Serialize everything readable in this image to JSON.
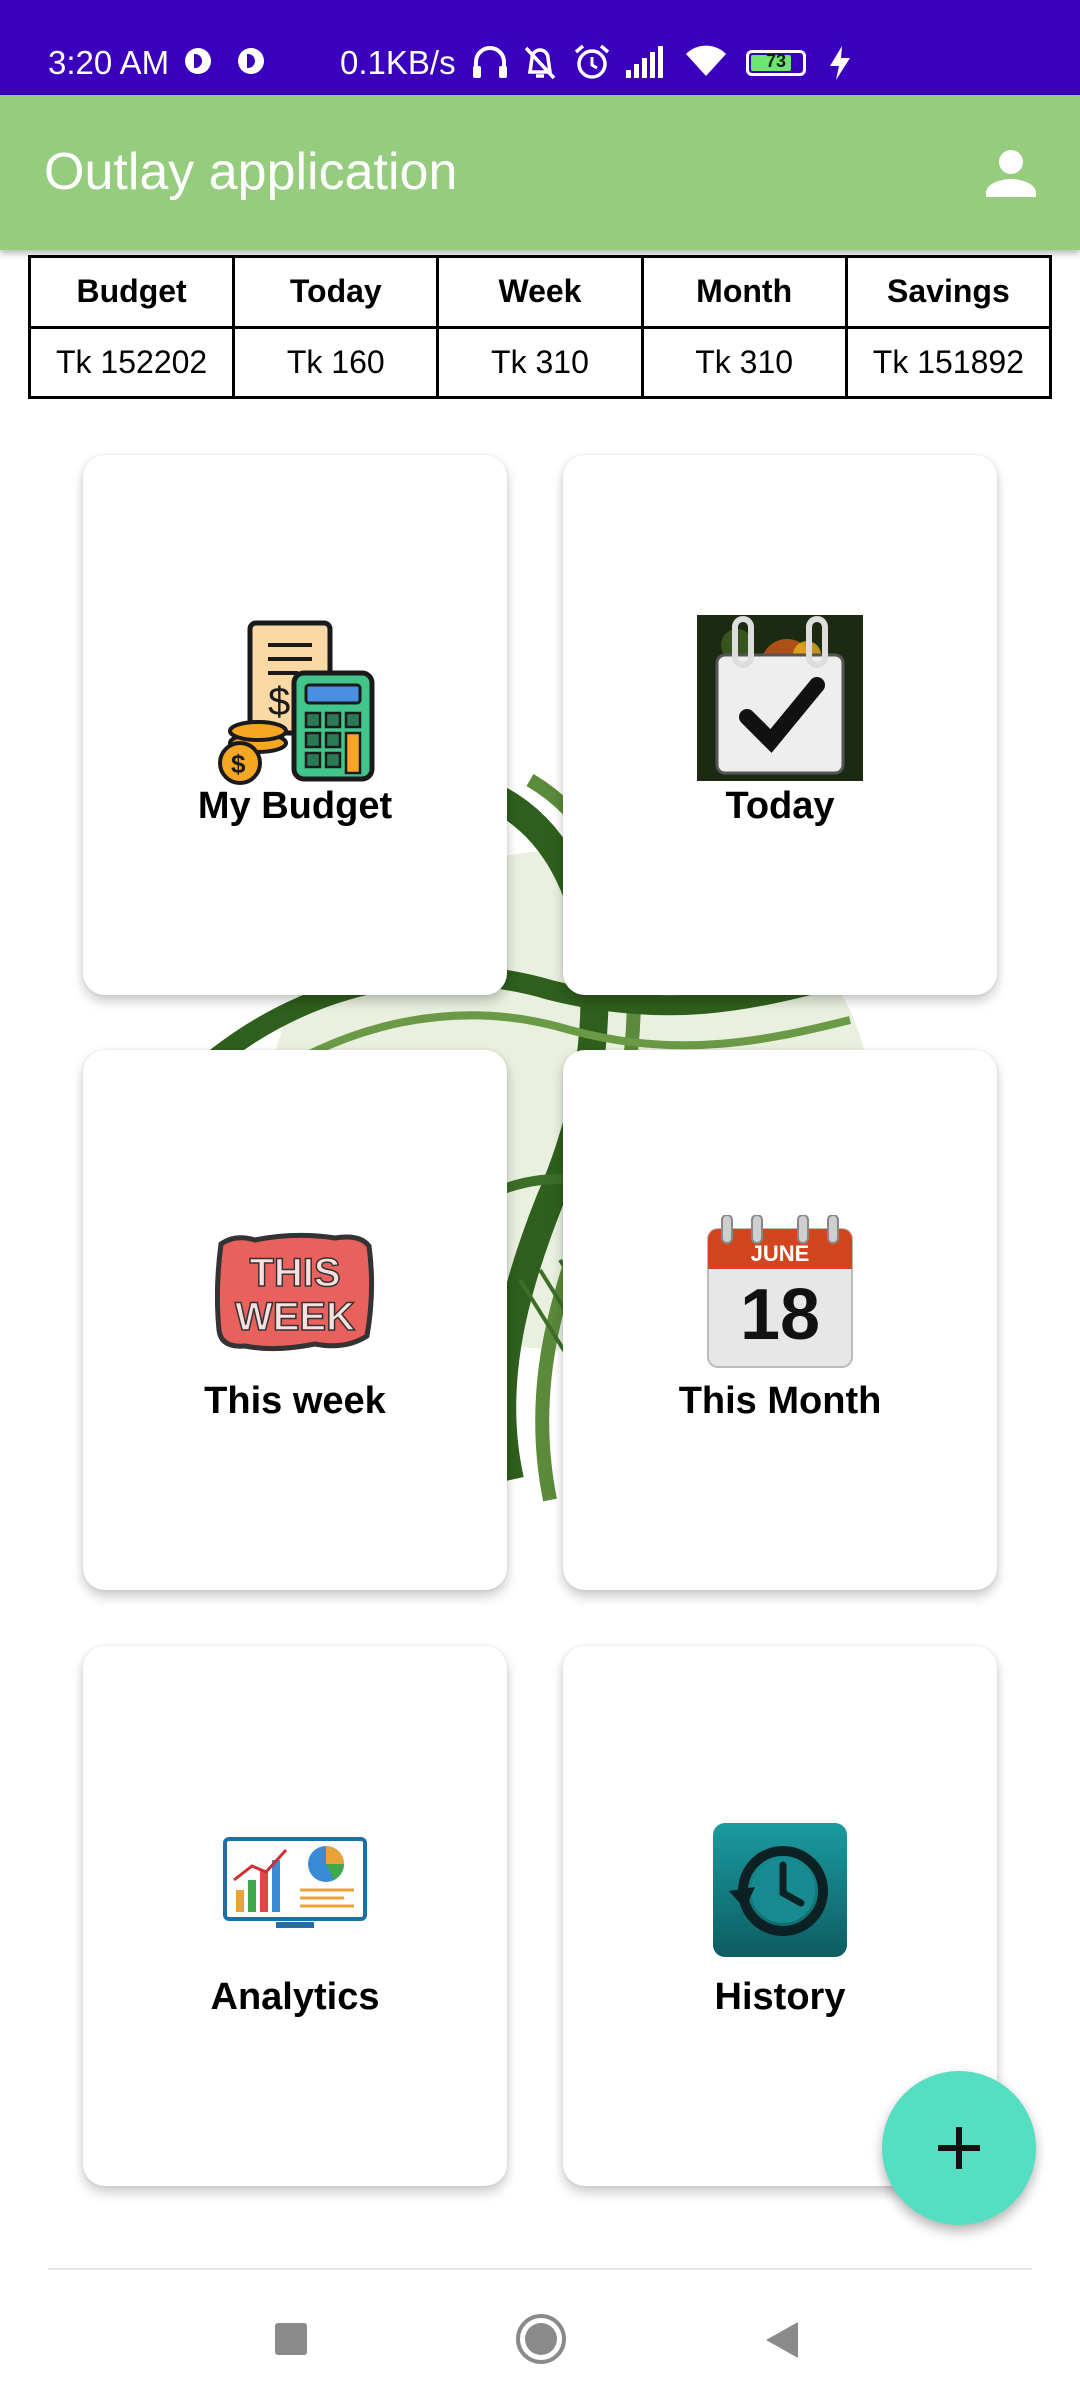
{
  "status_bar": {
    "time": "3:20 AM",
    "network_speed": "0.1KB/s",
    "battery_level": "73",
    "icons": [
      "headphones-icon",
      "bell-off-icon",
      "alarm-icon",
      "signal-icon",
      "wifi-icon",
      "battery-icon",
      "charging-icon"
    ]
  },
  "app_bar": {
    "title": "Outlay application",
    "profile_icon": "person-icon",
    "color": "#95cc7e"
  },
  "summary": {
    "headers": [
      "Budget",
      "Today",
      "Week",
      "Month",
      "Savings"
    ],
    "values": [
      "Tk 152202",
      "Tk 160",
      "Tk 310",
      "Tk 310",
      "Tk 151892"
    ]
  },
  "cards": [
    {
      "label": "My Budget",
      "icon": "budget-calculator-icon"
    },
    {
      "label": "Today",
      "icon": "calendar-check-icon"
    },
    {
      "label": "This week",
      "icon": "this-week-badge-icon"
    },
    {
      "label": "This Month",
      "icon": "calendar-page-icon",
      "calendar_month": "JUNE",
      "calendar_day": "18"
    },
    {
      "label": "Analytics",
      "icon": "analytics-monitor-icon"
    },
    {
      "label": "History",
      "icon": "history-clock-icon"
    }
  ],
  "fab": {
    "icon": "plus-icon",
    "color": "#55dfc2"
  },
  "nav_bar": {
    "buttons": [
      "recents-square-icon",
      "home-circle-icon",
      "back-triangle-icon"
    ]
  },
  "colors": {
    "status_bar": "#3a00bd",
    "accent": "#55dfc2"
  }
}
